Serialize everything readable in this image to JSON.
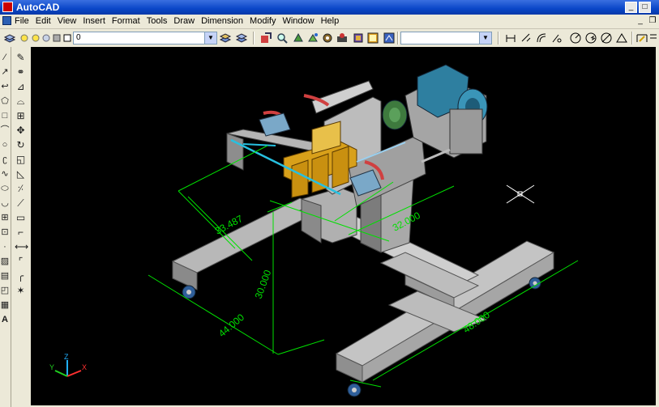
{
  "window": {
    "title": "AutoCAD",
    "controls": {
      "minimize": "_",
      "maximize": "□",
      "close": "×"
    }
  },
  "menu": {
    "items": [
      "File",
      "Edit",
      "View",
      "Insert",
      "Format",
      "Tools",
      "Draw",
      "Dimension",
      "Modify",
      "Window",
      "Help"
    ],
    "doc_controls": {
      "minimize": "_",
      "restore": "❐"
    }
  },
  "toolbar": {
    "layer_value": "0",
    "style_value": ""
  },
  "dimensions": {
    "d1": "33.487",
    "d2": "32.000",
    "d3": "30.000",
    "d4": "44.000",
    "d5": "48.000"
  },
  "ucs": {
    "x": "X",
    "y": "Y",
    "z": "Z"
  },
  "colors": {
    "titlebar": "#0a46c8",
    "dimension": "#00e000",
    "background": "#000000"
  }
}
